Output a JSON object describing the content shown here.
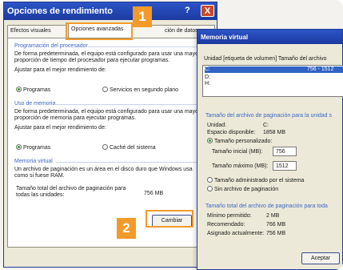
{
  "perf_dialog": {
    "title": "Opciones de rendimiento",
    "help_glyph": "?",
    "close_glyph": "X",
    "tabs": [
      {
        "label": "Efectos visuales"
      },
      {
        "label": "Opciones avanzadas"
      },
      {
        "label": "ción de datos"
      }
    ],
    "processor": {
      "header": "Programación del procesador",
      "text": "De forma predeterminada, el equipo está configurado para usar una mayor proporción de tiempo del procesador para ejecutar programas.",
      "adjust": "Ajustar para el mejor rendimiento de:",
      "opt_programs": "Programas",
      "opt_services": "Servicios en segundo plano"
    },
    "memory": {
      "header": "Uso de memoria",
      "text": "De forma predeterminada, el equipo está configurado para usar una mayor proporción de memoria para ejecutar programas.",
      "adjust": "Ajustar para el mejor rendimiento de:",
      "opt_programs": "Programas",
      "opt_cache": "Caché del sistema"
    },
    "virtual": {
      "header": "Memoria virtual",
      "text": "Un archivo de paginación es un área en el disco duro que Windows usa como si fuese RAM.",
      "total_label": "Tamaño total del archivo de paginación para todas las unidades:",
      "total_value": "756 MB",
      "change_button": "Cambiar"
    },
    "badges": {
      "one": "1",
      "two": "2"
    }
  },
  "vm_dialog": {
    "title": "Memoria virtual",
    "col_headers": "Unidad  [etiqueta de volumen]   Tamaño del archivo",
    "drives": [
      {
        "name": "C:",
        "size": "756 - 1512"
      },
      {
        "name": "D:",
        "size": ""
      },
      {
        "name": "H:",
        "size": ""
      }
    ],
    "selected_section": "Tamaño del archivo de paginación para la unidad s",
    "unit_label": "Unidad:",
    "unit_value": "C:",
    "space_label": "Espacio disponible:",
    "space_value": "1858 MB",
    "custom_size": "Tamaño personalizado:",
    "initial_label": "Tamaño inicial (MB):",
    "initial_value": "756",
    "max_label": "Tamaño máximo (MB):",
    "max_value": "1512",
    "system_managed": "Tamaño administrado por el sistema",
    "no_paging": "Sin archivo de paginación",
    "total_section": "Tamaño total del archivo de paginación para toda",
    "min_label": "Mínimo permitido:",
    "min_value": "2 MB",
    "rec_label": "Recomendado:",
    "rec_value": "766 MB",
    "assigned_label": "Asignado actualmente:",
    "assigned_value": "756 MB",
    "accept_button": "Aceptar"
  }
}
